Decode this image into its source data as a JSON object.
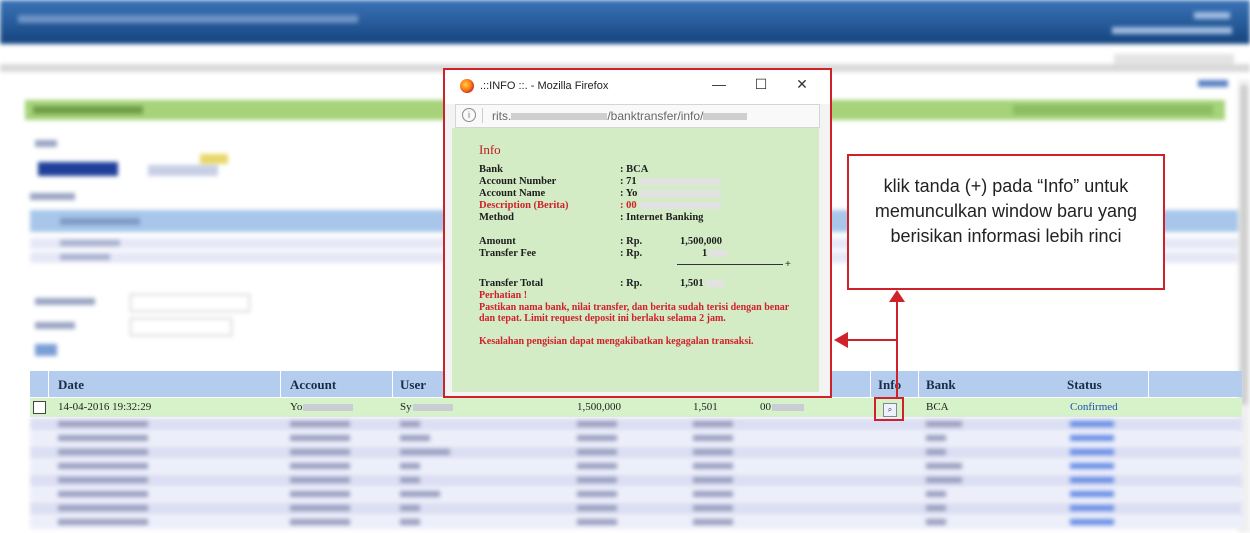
{
  "popup": {
    "window_title": ".::INFO ::. - Mozilla Firefox",
    "url_prefix": "rits.",
    "url_path": "/banktransfer/info/",
    "heading": "Info",
    "fields": [
      {
        "label": "Bank",
        "value": ": BCA"
      },
      {
        "label": "Account Number",
        "value": ": 71"
      },
      {
        "label": "Account Name",
        "value": ": Yo"
      },
      {
        "label": "Description (Berita)",
        "value": ": 00"
      },
      {
        "label": "Method",
        "value": ": Internet Banking"
      },
      {
        "label": "Amount",
        "value": ": Rp.",
        "amount": "1,500,000"
      },
      {
        "label": "Transfer Fee",
        "value": ": Rp.",
        "amount": "1"
      },
      {
        "label": "Transfer Total",
        "value": ": Rp.",
        "amount": "1,501"
      }
    ],
    "plus_sign": "+",
    "notice_title": "Perhatian !",
    "notice_lines": [
      "Pastikan nama bank, nilai transfer, dan berita sudah terisi dengan benar dan tepat. Limit request deposit ini berlaku selama 2 jam.",
      "Kesalahan pengisian dapat mengakibatkan kegagalan transaksi."
    ]
  },
  "callout": {
    "text": "klik tanda (+) pada “Info” untuk memunculkan window baru yang berisikan informasi lebih rinci"
  },
  "table": {
    "headers": [
      "Date",
      "Account",
      "User",
      "Info",
      "Bank",
      "Status"
    ],
    "row": {
      "date": "14-04-2016 19:32:29",
      "account": "Yo",
      "user": "Sy",
      "amount": "1,500,000",
      "total": "1,501",
      "desc": "00",
      "bank": "BCA",
      "status": "Confirmed"
    }
  },
  "colors": {
    "accent_red": "#d0202a",
    "status_blue": "#1f4fb4",
    "header_blue": "#b4cdee",
    "row_green": "#d6f2c9",
    "popup_green": "#d3ecc6"
  },
  "icons": {
    "browser": "firefox-icon",
    "info": "magnifier-icon"
  }
}
